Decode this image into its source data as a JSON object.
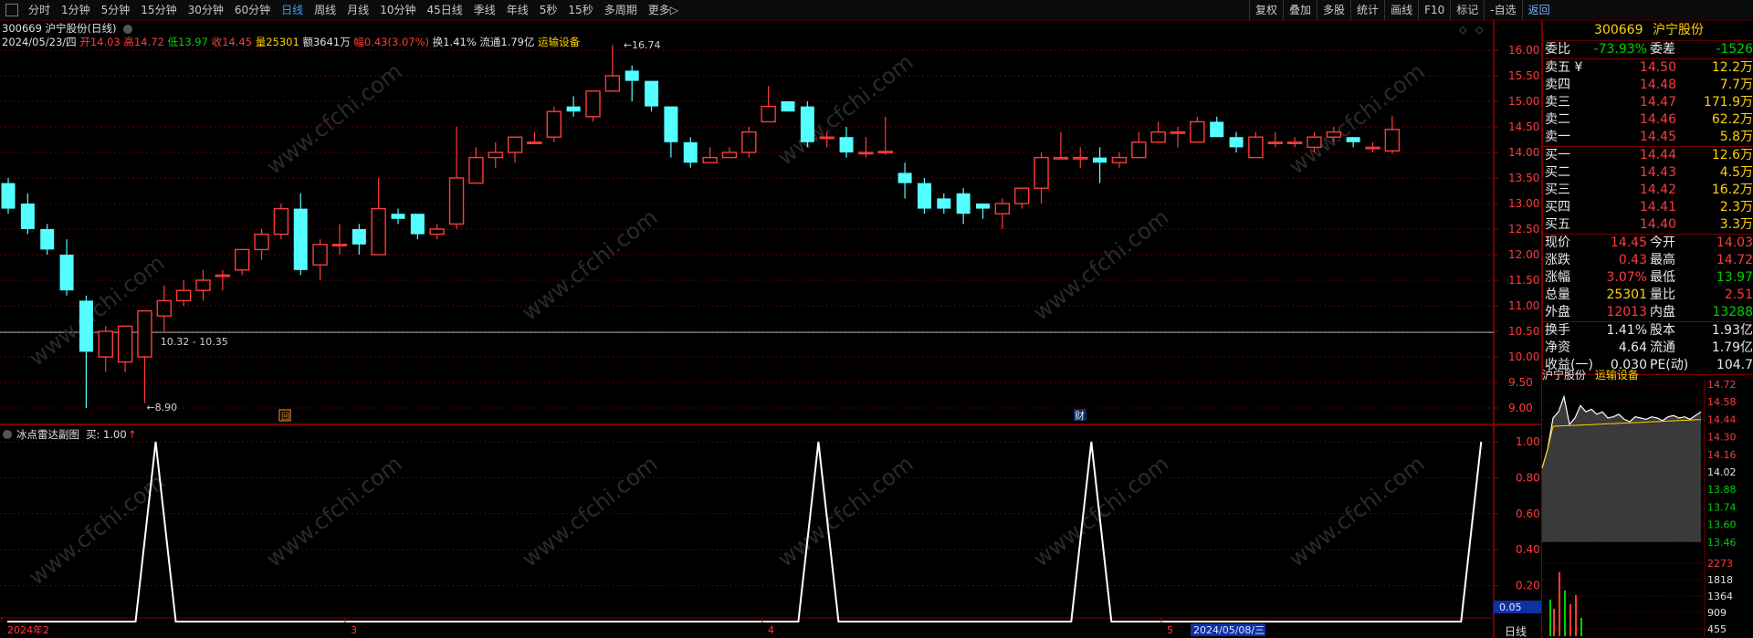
{
  "toolbar": {
    "periods": [
      "分时",
      "1分钟",
      "5分钟",
      "15分钟",
      "30分钟",
      "60分钟",
      "日线",
      "周线",
      "月线",
      "10分钟",
      "45日线",
      "季线",
      "年线",
      "5秒",
      "15秒",
      "多周期",
      "更多▷"
    ],
    "active_period": "日线",
    "tools": [
      "复权",
      "叠加",
      "多股",
      "统计",
      "画线",
      "F10",
      "标记",
      "-自选",
      "返回"
    ]
  },
  "header_line1": {
    "code_name": "300669 沪宁股份(日线)"
  },
  "header_line2": {
    "date": "2024/05/23/四",
    "open": "开14.03",
    "high": "高14.72",
    "low": "低13.97",
    "close": "收14.45",
    "volume": "量25301",
    "amount": "额3641万",
    "change": "幅0.43(3.07%)",
    "turnover": "换1.41%",
    "float": "流通1.79亿",
    "industry": "运输设备"
  },
  "chart_data": [
    {
      "type": "candlestick",
      "y_ticks": [
        "16.00",
        "15.50",
        "15.00",
        "14.50",
        "14.00",
        "13.50",
        "13.00",
        "12.50",
        "12.00",
        "11.50",
        "11.00",
        "10.50",
        "10.00",
        "9.50",
        "9.00"
      ],
      "ylim": [
        8.8,
        16.15
      ],
      "annotations": {
        "high_label": "16.74",
        "low_label": "8.90",
        "range_label": "10.32 - 10.35"
      },
      "markers": {
        "left": "回",
        "right": "财"
      },
      "candles": [
        [
          13.4,
          13.5,
          12.8,
          12.9
        ],
        [
          13.0,
          13.2,
          12.4,
          12.5
        ],
        [
          12.5,
          12.6,
          12.0,
          12.1
        ],
        [
          12.0,
          12.3,
          11.2,
          11.3
        ],
        [
          11.1,
          11.2,
          9.0,
          10.1
        ],
        [
          10.0,
          10.6,
          9.7,
          10.5
        ],
        [
          9.9,
          10.6,
          9.7,
          10.6
        ],
        [
          10.0,
          10.6,
          9.1,
          10.9
        ],
        [
          10.8,
          11.4,
          10.5,
          11.1
        ],
        [
          11.1,
          11.5,
          11.0,
          11.3
        ],
        [
          11.3,
          11.7,
          11.1,
          11.5
        ],
        [
          11.6,
          11.7,
          11.3,
          11.6
        ],
        [
          11.7,
          12.1,
          11.6,
          12.1
        ],
        [
          12.1,
          12.5,
          11.9,
          12.4
        ],
        [
          12.4,
          13.0,
          12.3,
          12.9
        ],
        [
          12.9,
          13.2,
          11.6,
          11.7
        ],
        [
          11.8,
          12.3,
          11.5,
          12.2
        ],
        [
          12.2,
          12.6,
          12.0,
          12.2
        ],
        [
          12.5,
          12.6,
          12.0,
          12.2
        ],
        [
          12.0,
          13.5,
          12.0,
          12.9
        ],
        [
          12.8,
          12.9,
          12.6,
          12.7
        ],
        [
          12.8,
          12.8,
          12.3,
          12.4
        ],
        [
          12.4,
          12.6,
          12.3,
          12.5
        ],
        [
          12.6,
          14.5,
          12.5,
          13.5
        ],
        [
          13.4,
          14.1,
          13.4,
          13.9
        ],
        [
          13.9,
          14.2,
          13.7,
          14.0
        ],
        [
          14.0,
          14.3,
          13.8,
          14.3
        ],
        [
          14.2,
          14.4,
          14.2,
          14.2
        ],
        [
          14.3,
          14.9,
          14.2,
          14.8
        ],
        [
          14.9,
          15.1,
          14.7,
          14.8
        ],
        [
          14.7,
          15.2,
          14.6,
          15.2
        ],
        [
          15.2,
          16.1,
          15.2,
          15.5
        ],
        [
          15.6,
          15.7,
          15.0,
          15.4
        ],
        [
          15.4,
          15.4,
          14.8,
          14.9
        ],
        [
          14.9,
          14.9,
          13.9,
          14.2
        ],
        [
          14.2,
          14.3,
          13.7,
          13.8
        ],
        [
          13.8,
          14.1,
          13.8,
          13.9
        ],
        [
          13.9,
          14.1,
          13.9,
          14.0
        ],
        [
          14.0,
          14.5,
          13.9,
          14.4
        ],
        [
          14.6,
          15.3,
          14.6,
          14.9
        ],
        [
          15.0,
          15.0,
          14.8,
          14.8
        ],
        [
          14.9,
          15.0,
          14.1,
          14.2
        ],
        [
          14.3,
          14.4,
          14.1,
          14.3
        ],
        [
          14.3,
          14.5,
          13.9,
          14.0
        ],
        [
          14.0,
          14.3,
          13.9,
          14.0
        ],
        [
          14.0,
          14.7,
          13.95,
          14.02
        ],
        [
          13.6,
          13.8,
          13.1,
          13.4
        ],
        [
          13.4,
          13.5,
          12.8,
          12.9
        ],
        [
          13.1,
          13.2,
          12.8,
          12.9
        ],
        [
          13.2,
          13.3,
          12.6,
          12.8
        ],
        [
          13.0,
          13.0,
          12.7,
          12.9
        ],
        [
          12.8,
          13.1,
          12.5,
          13.0
        ],
        [
          13.0,
          13.3,
          12.9,
          13.3
        ],
        [
          13.3,
          14.0,
          13.0,
          13.9
        ],
        [
          13.9,
          14.4,
          13.9,
          13.9
        ],
        [
          13.9,
          14.1,
          13.7,
          13.9
        ],
        [
          13.9,
          14.1,
          13.4,
          13.8
        ],
        [
          13.8,
          14.0,
          13.7,
          13.9
        ],
        [
          13.9,
          14.4,
          13.9,
          14.2
        ],
        [
          14.2,
          14.6,
          14.2,
          14.4
        ],
        [
          14.4,
          14.5,
          14.1,
          14.4
        ],
        [
          14.2,
          14.7,
          14.2,
          14.6
        ],
        [
          14.6,
          14.7,
          14.4,
          14.3
        ],
        [
          14.3,
          14.4,
          14.0,
          14.1
        ],
        [
          13.9,
          14.4,
          13.9,
          14.3
        ],
        [
          14.2,
          14.4,
          14.1,
          14.2
        ],
        [
          14.2,
          14.3,
          14.1,
          14.2
        ],
        [
          14.1,
          14.4,
          14.0,
          14.3
        ],
        [
          14.3,
          14.5,
          14.2,
          14.4
        ],
        [
          14.3,
          14.3,
          14.1,
          14.2
        ],
        [
          14.1,
          14.2,
          14.0,
          14.1
        ],
        [
          14.03,
          14.72,
          13.97,
          14.45
        ]
      ]
    },
    {
      "type": "line",
      "title": "冰点雷达副图",
      "series_label": "买: 1.00",
      "y_ticks": [
        "1.00",
        "0.80",
        "0.60",
        "0.40",
        "0.20"
      ],
      "ylim": [
        0,
        1
      ],
      "cursor_value": "0.05",
      "peaks_at_candle": [
        7,
        41,
        55,
        75
      ],
      "x_labels": [
        "2024年2",
        "3",
        "4",
        "5"
      ],
      "date_label": "2024/05/08/三",
      "period_label": "日线"
    }
  ],
  "quote": {
    "code": "300669",
    "name": "沪宁股份",
    "weibi_label": "委比",
    "weibi": "-73.93%",
    "weicha_label": "委差",
    "weicha": "-1526",
    "asks": [
      {
        "label": "卖五 ¥",
        "price": "14.50",
        "vol": "12.2万"
      },
      {
        "label": "卖四",
        "price": "14.48",
        "vol": "7.7万"
      },
      {
        "label": "卖三",
        "price": "14.47",
        "vol": "171.9万"
      },
      {
        "label": "卖二",
        "price": "14.46",
        "vol": "62.2万"
      },
      {
        "label": "卖一",
        "price": "14.45",
        "vol": "5.8万"
      }
    ],
    "bids": [
      {
        "label": "买一",
        "price": "14.44",
        "vol": "12.6万"
      },
      {
        "label": "买二",
        "price": "14.43",
        "vol": "4.5万"
      },
      {
        "label": "买三",
        "price": "14.42",
        "vol": "16.2万"
      },
      {
        "label": "买四",
        "price": "14.41",
        "vol": "2.3万"
      },
      {
        "label": "买五",
        "price": "14.40",
        "vol": "3.3万"
      }
    ],
    "stats": [
      {
        "l1": "现价",
        "v1": "14.45",
        "c1": "red",
        "l2": "今开",
        "v2": "14.03",
        "c2": "red"
      },
      {
        "l1": "涨跌",
        "v1": "0.43",
        "c1": "red",
        "l2": "最高",
        "v2": "14.72",
        "c2": "red"
      },
      {
        "l1": "涨幅",
        "v1": "3.07%",
        "c1": "red",
        "l2": "最低",
        "v2": "13.97",
        "c2": "green"
      },
      {
        "l1": "总量",
        "v1": "25301",
        "c1": "yellow",
        "l2": "量比",
        "v2": "2.51",
        "c2": "red"
      },
      {
        "l1": "外盘",
        "v1": "12013",
        "c1": "red",
        "l2": "内盘",
        "v2": "13288",
        "c2": "green"
      }
    ],
    "stats2": [
      {
        "l1": "换手",
        "v1": "1.41%",
        "l2": "股本",
        "v2": "1.93亿"
      },
      {
        "l1": "净资",
        "v1": "4.64",
        "l2": "流通",
        "v2": "1.79亿"
      },
      {
        "l1": "收益(一)",
        "v1": "0.030",
        "l2": "PE(动)",
        "v2": "104.7"
      }
    ]
  },
  "mini_chart": {
    "name": "沪宁股份",
    "industry": "运输设备",
    "price_ticks": [
      "14.72",
      "14.58",
      "14.44",
      "14.30",
      "14.16",
      "14.02",
      "13.88",
      "13.74",
      "13.60",
      "13.46"
    ],
    "volume_ticks": [
      "2273",
      "1818",
      "1364",
      "909",
      "455"
    ]
  },
  "colors": {
    "up": "#ff3b3b",
    "down": "#54ffff",
    "line": "#ffffff",
    "grid": "#6a0000"
  }
}
